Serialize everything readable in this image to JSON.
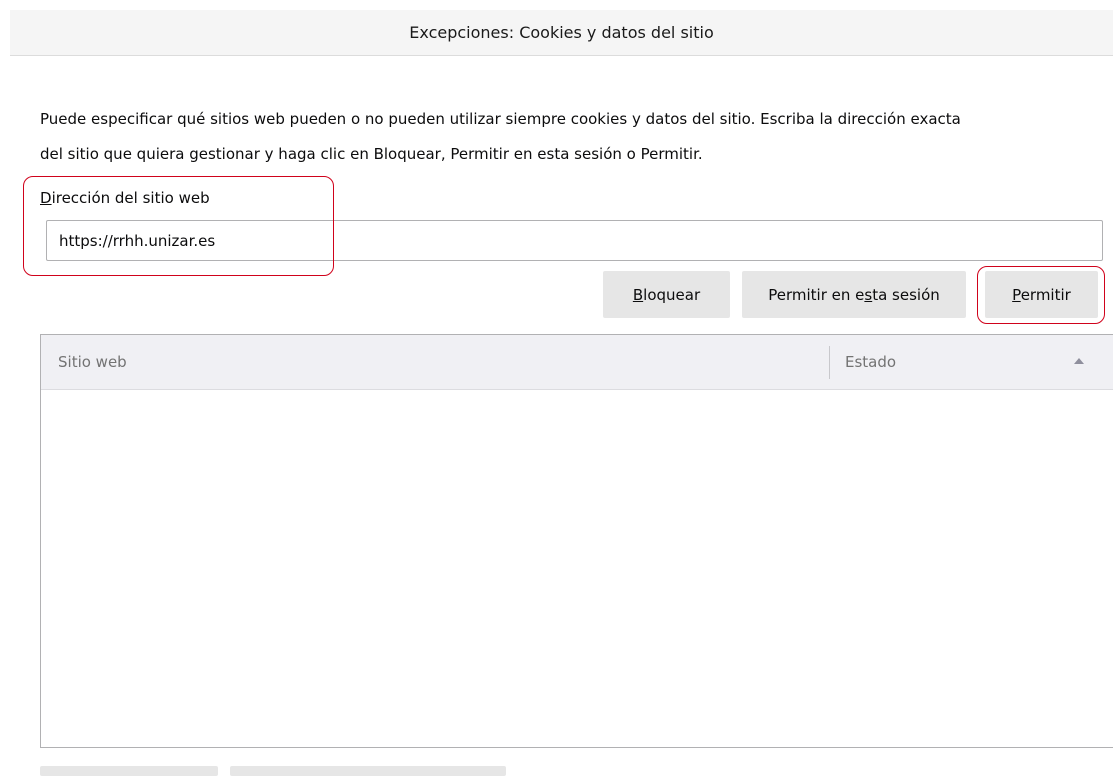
{
  "dialog": {
    "title": "Excepciones: Cookies y datos del sitio"
  },
  "description": {
    "line1": "Puede especificar qué sitios web pueden o no pueden utilizar siempre cookies y datos del sitio. Escriba la dirección exacta",
    "line2": "del sitio que quiera gestionar y haga clic en Bloquear, Permitir en esta sesión o Permitir."
  },
  "address_field": {
    "label_accesskey": "D",
    "label_rest": "irección del sitio web",
    "value": "https://rrhh.unizar.es"
  },
  "buttons": {
    "block": {
      "accesskey": "B",
      "rest": "loquear"
    },
    "session": {
      "before": "Permitir en e",
      "accesskey": "s",
      "after": "ta sesión"
    },
    "allow": {
      "accesskey": "P",
      "rest": "ermitir"
    }
  },
  "table": {
    "columns": [
      "Sitio web",
      "Estado"
    ],
    "sort_column": "Estado",
    "sort_direction": "ascending",
    "rows": []
  },
  "annotation_color": "#d0021b"
}
